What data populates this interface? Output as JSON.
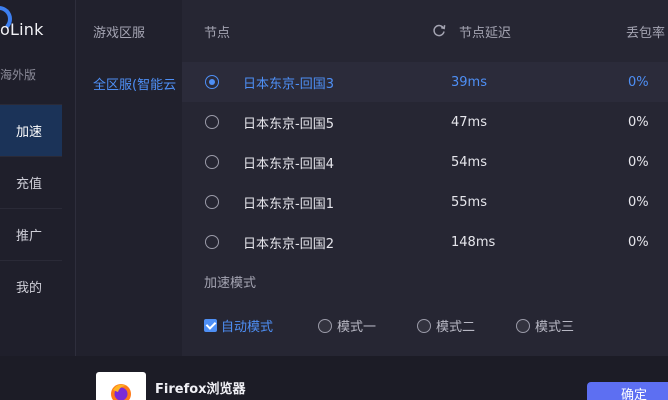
{
  "app": {
    "name": "oLink",
    "edition": "海外版"
  },
  "nav": {
    "items": [
      {
        "label": "加速",
        "active": true
      },
      {
        "label": "充值",
        "active": false
      },
      {
        "label": "推广",
        "active": false
      },
      {
        "label": "我的",
        "active": false
      }
    ]
  },
  "region": {
    "header": "游戏区服",
    "selected": "全区服(智能云"
  },
  "nodes": {
    "header_node": "节点",
    "header_latency": "节点延迟",
    "header_loss": "丢包率",
    "rows": [
      {
        "name": "日本东京-回国3",
        "latency": "39ms",
        "loss": "0%",
        "selected": true
      },
      {
        "name": "日本东京-回国5",
        "latency": "47ms",
        "loss": "0%",
        "selected": false
      },
      {
        "name": "日本东京-回国4",
        "latency": "54ms",
        "loss": "0%",
        "selected": false
      },
      {
        "name": "日本东京-回国1",
        "latency": "55ms",
        "loss": "0%",
        "selected": false
      },
      {
        "name": "日本东京-回国2",
        "latency": "148ms",
        "loss": "0%",
        "selected": false
      }
    ]
  },
  "mode": {
    "label": "加速模式",
    "options": [
      {
        "label": "自动模式",
        "checked": true
      },
      {
        "label": "模式一",
        "checked": false
      },
      {
        "label": "模式二",
        "checked": false
      },
      {
        "label": "模式三",
        "checked": false
      }
    ]
  },
  "footer": {
    "browser_name": "Firefox浏览器",
    "confirm_label": "确定"
  },
  "colors": {
    "accent": "#4e8ff5",
    "button": "#5d6ff2",
    "background": "#242431"
  },
  "icons": {
    "refresh": "refresh-icon",
    "browser": "firefox-icon",
    "logo": "logo-arc-icon"
  }
}
